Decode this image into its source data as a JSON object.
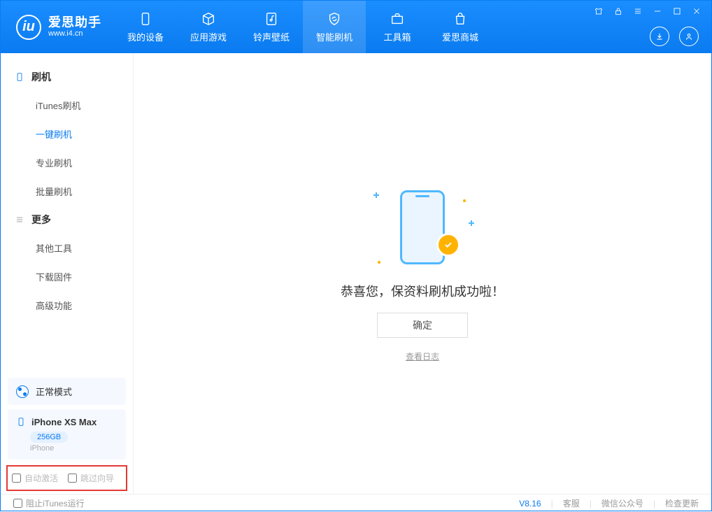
{
  "app": {
    "title": "爱思助手",
    "subtitle": "www.i4.cn"
  },
  "tabs": {
    "device": "我的设备",
    "apps": "应用游戏",
    "ringtone": "铃声壁纸",
    "flash": "智能刷机",
    "toolbox": "工具箱",
    "store": "爱思商城"
  },
  "sidebar": {
    "group1_title": "刷机",
    "items1": {
      "itunes": "iTunes刷机",
      "oneclick": "一键刷机",
      "pro": "专业刷机",
      "batch": "批量刷机"
    },
    "group2_title": "更多",
    "items2": {
      "other": "其他工具",
      "firmware": "下载固件",
      "advanced": "高级功能"
    }
  },
  "mode": {
    "label": "正常模式"
  },
  "device": {
    "name": "iPhone XS Max",
    "storage": "256GB",
    "type": "iPhone"
  },
  "checks": {
    "auto_activate": "自动激活",
    "skip_guide": "跳过向导"
  },
  "main": {
    "success_text": "恭喜您，保资料刷机成功啦！",
    "confirm": "确定",
    "view_log": "查看日志"
  },
  "footer": {
    "block_itunes": "阻止iTunes运行",
    "version": "V8.16",
    "support": "客服",
    "wechat": "微信公众号",
    "update": "检查更新"
  }
}
